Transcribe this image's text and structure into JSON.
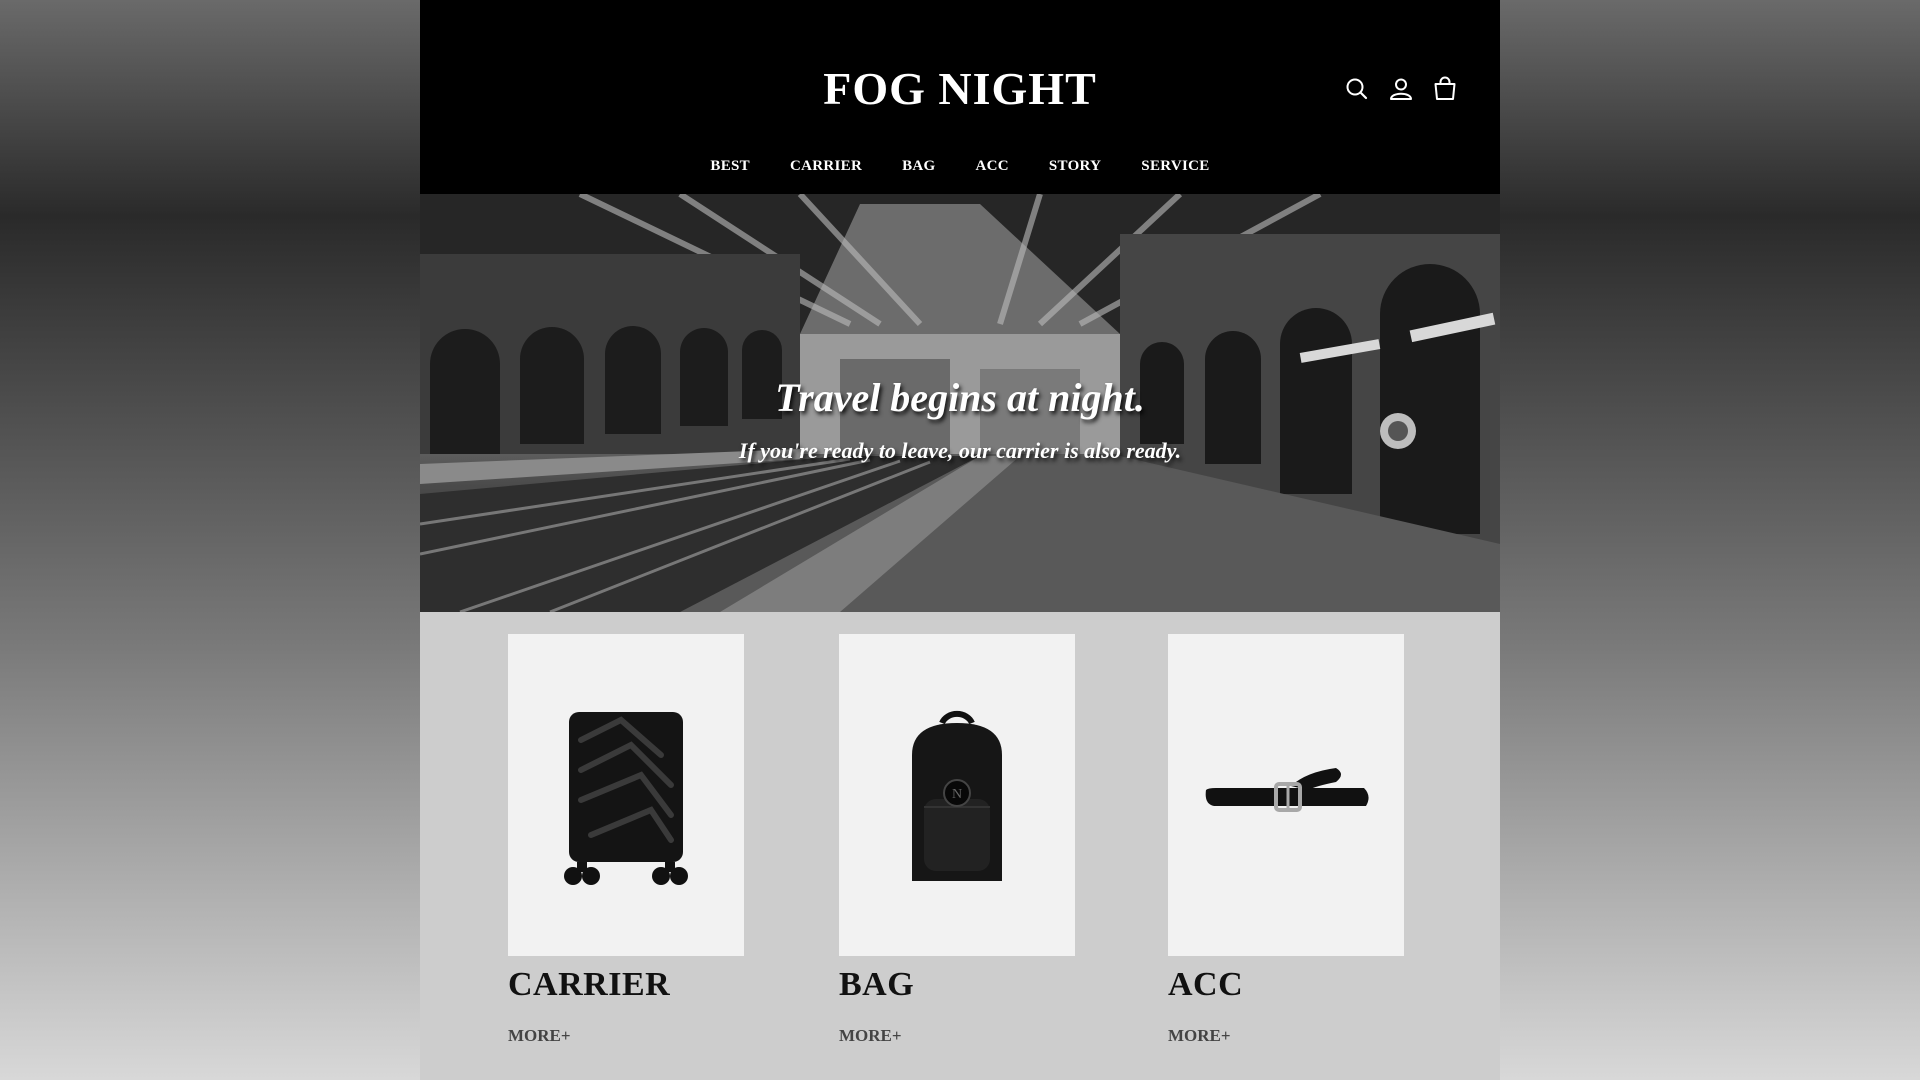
{
  "brand": {
    "logo_text": "FOG NIGHT"
  },
  "header": {
    "icons": [
      "search-icon",
      "user-icon",
      "shopping-bag-icon"
    ]
  },
  "nav": {
    "items": [
      {
        "label": "BEST"
      },
      {
        "label": "CARRIER"
      },
      {
        "label": "BAG"
      },
      {
        "label": "ACC"
      },
      {
        "label": "STORY"
      },
      {
        "label": "SERVICE"
      }
    ]
  },
  "hero": {
    "title": "Travel begins at night.",
    "subtitle": "If you're ready to leave, our carrier is also ready."
  },
  "products": [
    {
      "title": "CARRIER",
      "more": "MORE+",
      "image": "suitcase"
    },
    {
      "title": "BAG",
      "more": "MORE+",
      "image": "backpack"
    },
    {
      "title": "ACC",
      "more": "MORE+",
      "image": "belt"
    }
  ],
  "colors": {
    "header_bg": "#000000",
    "page_bg": "#cdcdcd",
    "card_bg": "#f2f2f2"
  }
}
